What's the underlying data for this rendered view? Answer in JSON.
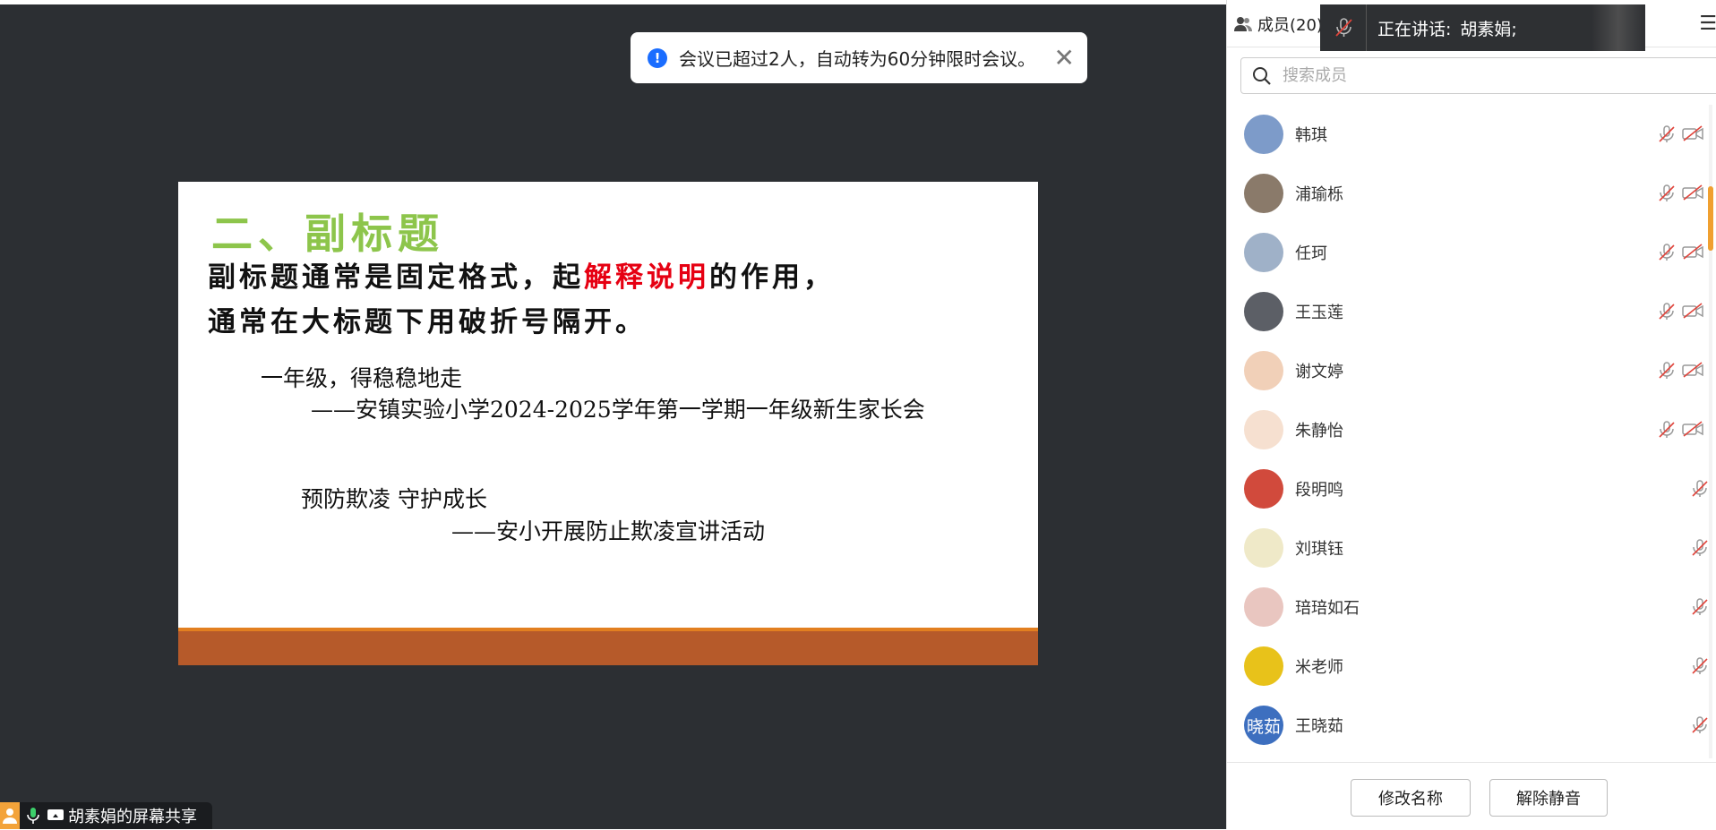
{
  "toast": {
    "message": "会议已超过2人，自动转为60分钟限时会议。",
    "info_icon": "!",
    "close_icon": "✕"
  },
  "slide": {
    "title": "二、副标题",
    "para_line1_a": "副标题通常是固定格式，起",
    "para_line1_red": "解释说明",
    "para_line1_b": "的作用，",
    "para_line2": "通常在大标题下用破折号隔开。",
    "example1_title": "一年级，得稳稳地走",
    "example1_sub": "——安镇实验小学2024-2025学年第一学期一年级新生家长会",
    "example2_title": "预防欺凌  守护成长",
    "example2_sub": "——安小开展防止欺凌宣讲活动",
    "colors": {
      "title": "#8dc54b",
      "highlight": "#e60012",
      "bar_top": "#e27f20",
      "bar_bottom": "#b65a2a"
    }
  },
  "share_bar": {
    "label": "胡素娟的屏幕共享"
  },
  "panel": {
    "tab_label": "成员(20)",
    "speaking_label": "正在讲话:",
    "speaking_name": "胡素娟;",
    "search_placeholder": "搜索成员",
    "members": [
      {
        "name": "韩琪",
        "avatar_color": "#7d9bc9",
        "avatar_text": "",
        "video_off": true
      },
      {
        "name": "浦瑜栎",
        "avatar_color": "#8a7a6a",
        "avatar_text": "",
        "video_off": true
      },
      {
        "name": "任珂",
        "avatar_color": "#9fb1c8",
        "avatar_text": "",
        "video_off": true
      },
      {
        "name": "王玉莲",
        "avatar_color": "#5c5f66",
        "avatar_text": "",
        "video_off": true
      },
      {
        "name": "谢文婷",
        "avatar_color": "#f1d0b8",
        "avatar_text": "",
        "video_off": true
      },
      {
        "name": "朱静怡",
        "avatar_color": "#f6e0d0",
        "avatar_text": "",
        "video_off": true
      },
      {
        "name": "段明鸣",
        "avatar_color": "#d14a3c",
        "avatar_text": "",
        "video_off": false
      },
      {
        "name": "刘琪钰",
        "avatar_color": "#efe9c8",
        "avatar_text": "",
        "video_off": false
      },
      {
        "name": "琣琣如石",
        "avatar_color": "#e9c6c0",
        "avatar_text": "",
        "video_off": false
      },
      {
        "name": "米老师",
        "avatar_color": "#e8c21a",
        "avatar_text": "",
        "video_off": false
      },
      {
        "name": "王晓茹",
        "avatar_color": "#3d6fbf",
        "avatar_text": "晓茹",
        "video_off": false
      }
    ],
    "rename_button": "修改名称",
    "unmute_button": "解除静音"
  }
}
